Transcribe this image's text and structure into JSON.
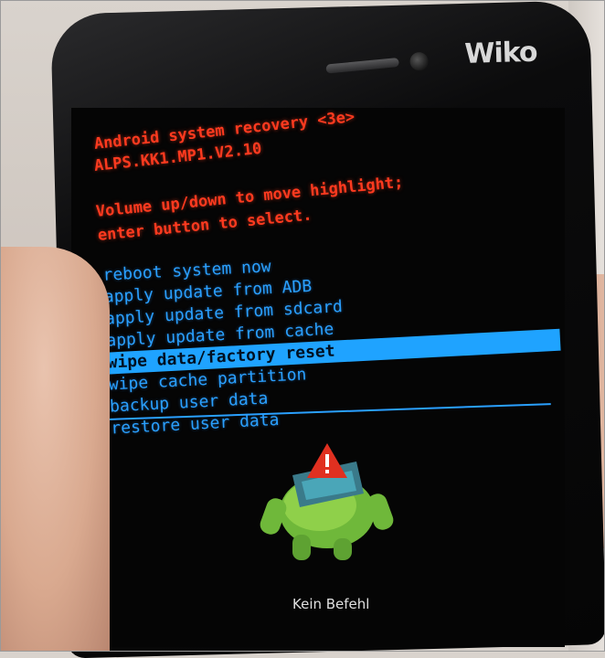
{
  "device": {
    "brand": "Wiko"
  },
  "recovery": {
    "title": "Android system recovery <3e>",
    "version": "ALPS.KK1.MP1.V2.10",
    "instruction_line1": "Volume up/down to move highlight;",
    "instruction_line2": "enter button to select.",
    "menu": [
      {
        "label": "reboot system now",
        "selected": false
      },
      {
        "label": "apply update from ADB",
        "selected": false
      },
      {
        "label": "apply update from sdcard",
        "selected": false
      },
      {
        "label": "apply update from cache",
        "selected": false
      },
      {
        "label": "wipe data/factory reset",
        "selected": true
      },
      {
        "label": "wipe cache partition",
        "selected": false
      },
      {
        "label": "backup user data",
        "selected": false
      },
      {
        "label": "restore user data",
        "selected": false
      }
    ],
    "status": "Kein Befehl"
  },
  "colors": {
    "header_text": "#ff3a1f",
    "menu_text": "#2aa0ff",
    "highlight": "#1fa3ff"
  }
}
